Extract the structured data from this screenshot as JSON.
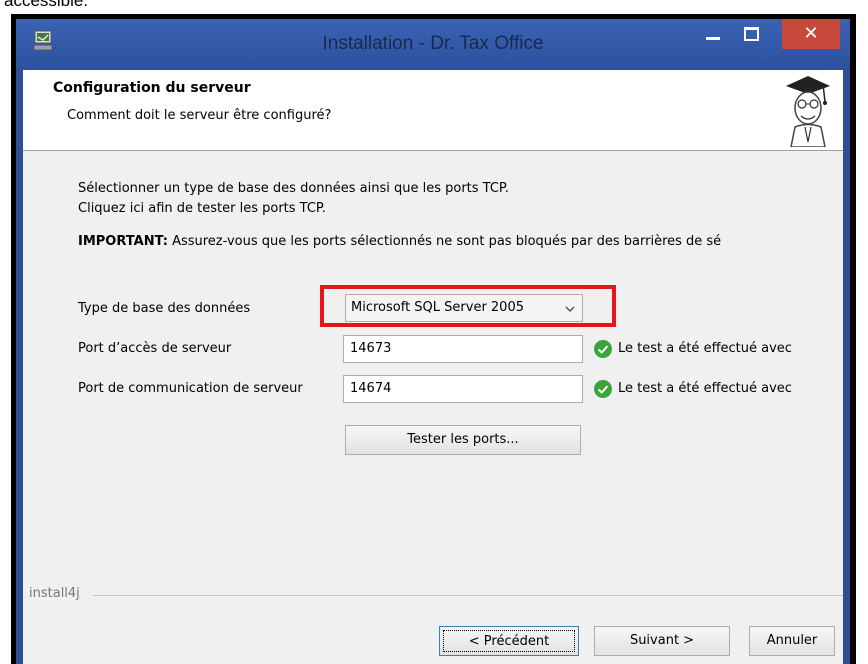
{
  "page_top_text": "accessible.",
  "window": {
    "title": "Installation - Dr. Tax Office",
    "close_glyph": "✕"
  },
  "header": {
    "title": "Configuration du serveur",
    "subtitle": "Comment doit le serveur être configuré?"
  },
  "body": {
    "line1": "Sélectionner un type de base des données ainsi que les ports TCP.",
    "line2": "Cliquez ici afin de tester les ports TCP.",
    "important_label": "IMPORTANT:",
    "important_text": " Assurez-vous que les ports sélectionnés ne sont pas bloqués par des barrières de sé"
  },
  "form": {
    "db_type_label": "Type de base des données",
    "db_type_value": "Microsoft SQL Server 2005",
    "access_port_label": "Port d’accès de serveur",
    "access_port_value": "14673",
    "access_port_status": "Le test a été effectué avec",
    "comm_port_label": "Port de communication de serveur",
    "comm_port_value": "14674",
    "comm_port_status": "Le test a été effectué avec",
    "test_button": "Tester les ports..."
  },
  "footer": {
    "brand": "install4j",
    "back_button": "< Précédent",
    "next_button": "Suivant >",
    "cancel_button": "Annuler"
  },
  "colors": {
    "highlight": "#e8141c",
    "check": "#3aa53a",
    "titlebar": "#2f4f95",
    "close": "#c7493c"
  },
  "icons": [
    "app-installer-icon",
    "minimize-icon",
    "maximize-icon",
    "close-icon",
    "graduate-logo",
    "chevron-down-icon",
    "check-circle-icon"
  ]
}
